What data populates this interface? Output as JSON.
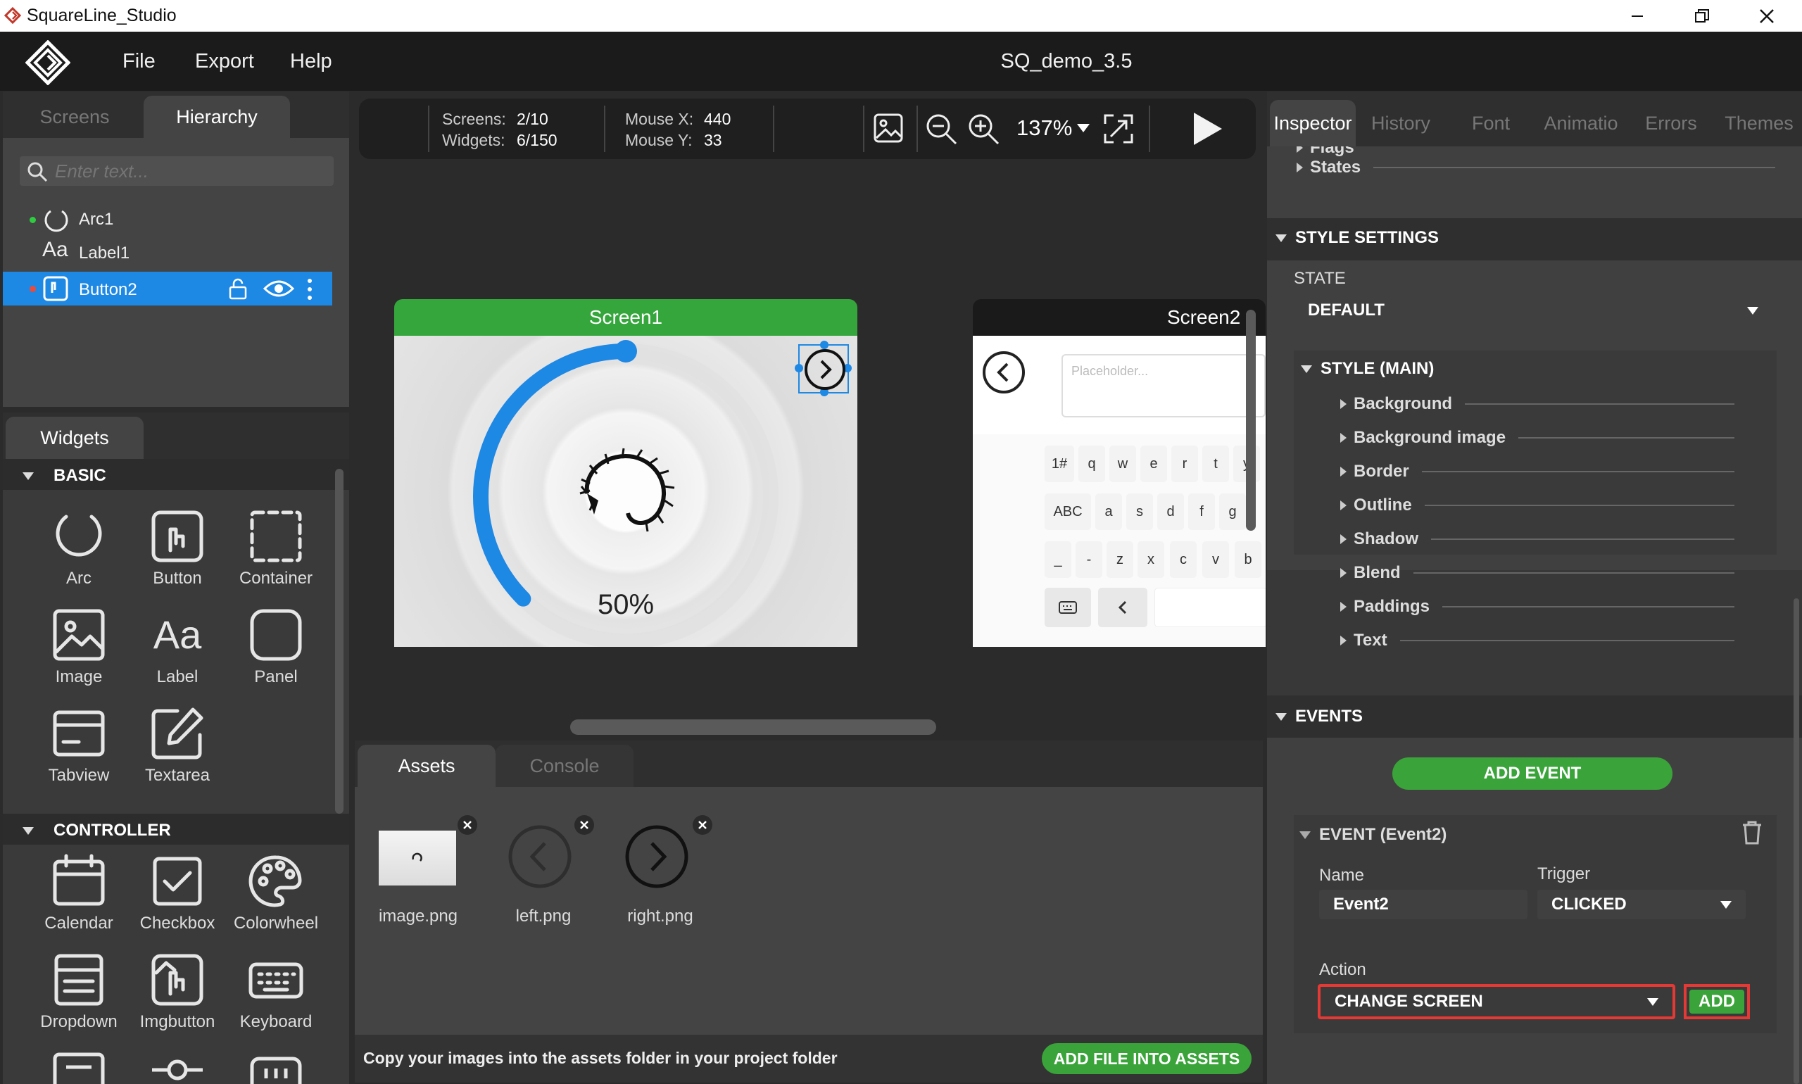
{
  "app": {
    "title": "SquareLine_Studio",
    "project": "SQ_demo_3.5"
  },
  "menu": [
    "File",
    "Export",
    "Help"
  ],
  "left_tabs": {
    "screens": "Screens",
    "hierarchy": "Hierarchy"
  },
  "search": {
    "placeholder": "Enter text..."
  },
  "hierarchy": [
    {
      "name": "Arc1",
      "icon": "arc-icon",
      "dot": "#2ecc40"
    },
    {
      "name": "Label1",
      "icon": "label-icon",
      "dot": ""
    },
    {
      "name": "Button2",
      "icon": "button-icon",
      "dot": "#e74c3c",
      "selected": true
    }
  ],
  "widgets": {
    "tab": "Widgets",
    "basic_title": "BASIC",
    "basic": [
      "Arc",
      "Button",
      "Container",
      "Image",
      "Label",
      "Panel",
      "Tabview",
      "Textarea"
    ],
    "controller_title": "CONTROLLER",
    "controller": [
      "Calendar",
      "Checkbox",
      "Colorwheel",
      "Dropdown",
      "Imgbutton",
      "Keyboard"
    ]
  },
  "toolbar": {
    "screens_label": "Screens:",
    "screens_value": "2/10",
    "widgets_label": "Widgets:",
    "widgets_value": "6/150",
    "mousex_label": "Mouse X:",
    "mousex_value": "440",
    "mousey_label": "Mouse Y:",
    "mousey_value": "33",
    "zoom": "137%"
  },
  "canvas": {
    "screen1": {
      "title": "Screen1",
      "title_color": "#35a63c",
      "arc_value": "50%",
      "arc_fraction": 0.5
    },
    "screen2": {
      "title": "Screen2",
      "placeholder": "Placeholder...",
      "keys_row1": [
        "1#",
        "q",
        "w",
        "e",
        "r",
        "t",
        "y"
      ],
      "keys_row2": [
        "ABC",
        "a",
        "s",
        "d",
        "f",
        "g"
      ],
      "keys_row3": [
        "_",
        "-",
        "z",
        "x",
        "c",
        "v",
        "b"
      ]
    }
  },
  "bottom_tabs": {
    "assets": "Assets",
    "console": "Console"
  },
  "assets": [
    {
      "name": "image.png"
    },
    {
      "name": "left.png"
    },
    {
      "name": "right.png"
    }
  ],
  "assets_footer": {
    "hint": "Copy your images into the assets folder in your project folder",
    "button": "ADD FILE INTO ASSETS"
  },
  "right_tabs": [
    "Inspector",
    "History",
    "Font",
    "Animatio",
    "Errors",
    "Themes"
  ],
  "inspector": {
    "flags": "Flags",
    "states": "States",
    "style_settings": "STYLE SETTINGS",
    "state_label": "STATE",
    "state_value": "DEFAULT",
    "style_main": "STYLE (MAIN)",
    "style_props": [
      "Background",
      "Background image",
      "Border",
      "Outline",
      "Shadow",
      "Blend",
      "Paddings",
      "Text"
    ],
    "events_title": "EVENTS",
    "add_event": "ADD EVENT",
    "event_title": "EVENT (Event2)",
    "name_label": "Name",
    "name_value": "Event2",
    "trigger_label": "Trigger",
    "trigger_value": "CLICKED",
    "action_label": "Action",
    "action_value": "CHANGE SCREEN",
    "add": "ADD"
  },
  "colors": {
    "accent_blue": "#1e88e5",
    "green": "#3aa43a",
    "highlight_red": "#e53935"
  }
}
